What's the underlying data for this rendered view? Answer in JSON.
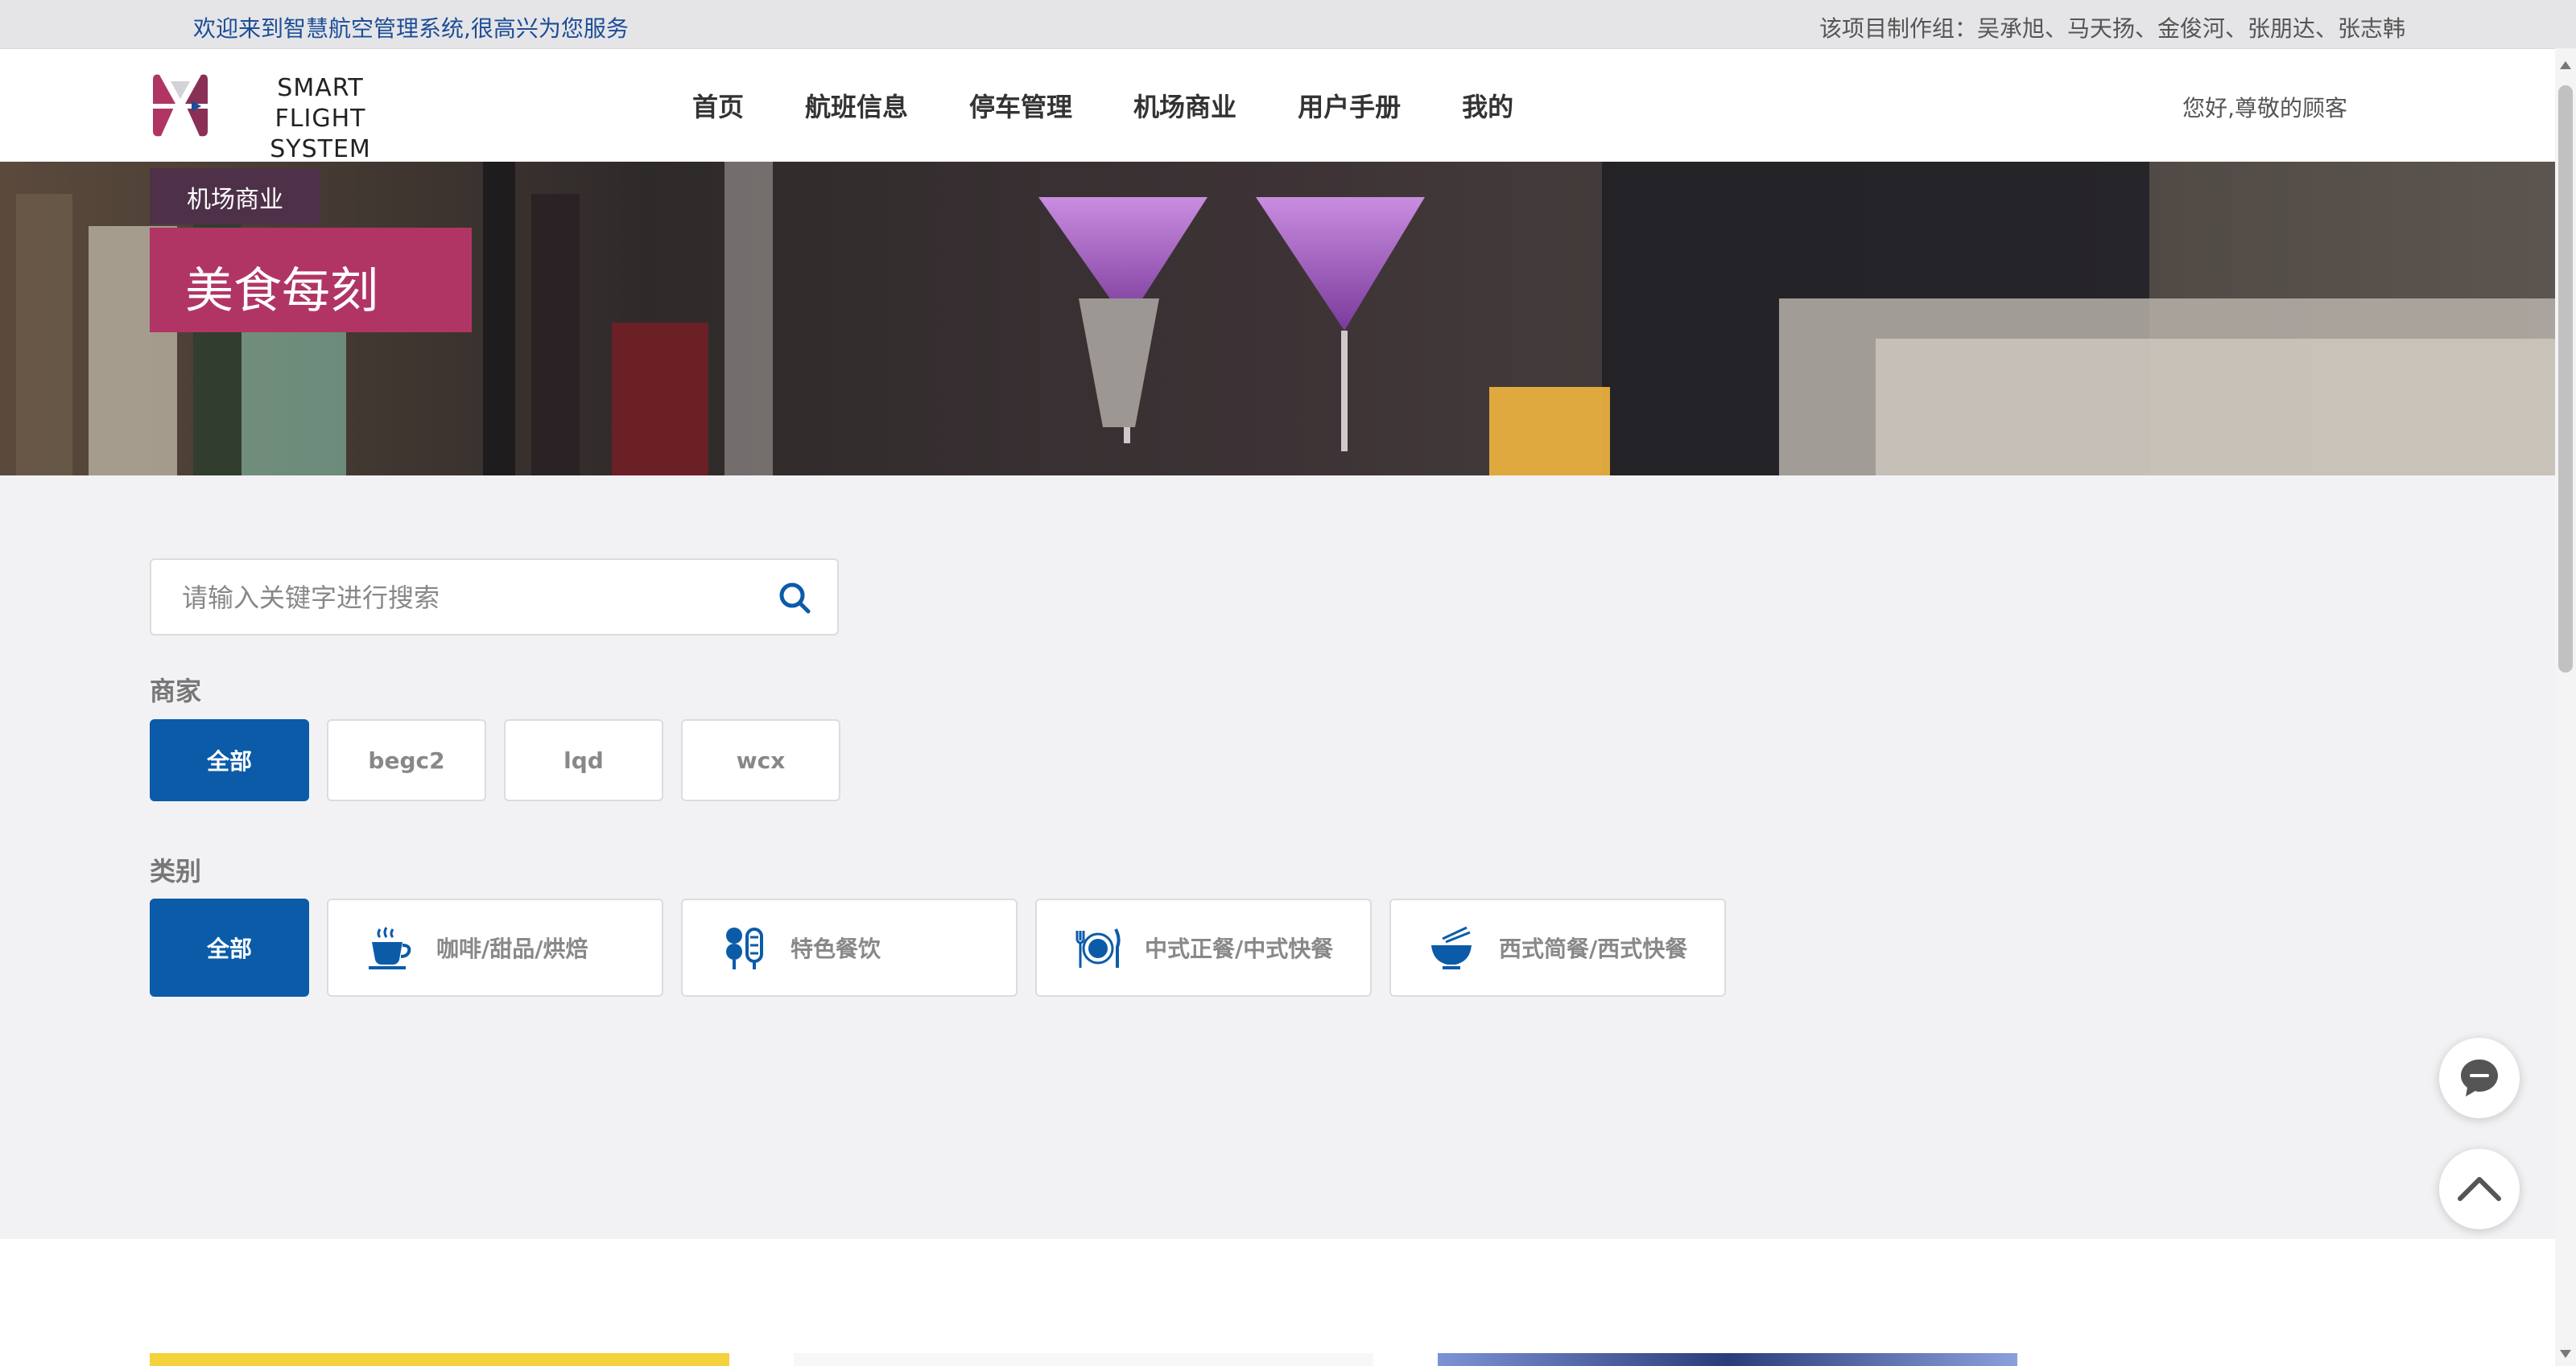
{
  "topbar": {
    "welcome": "欢迎来到智慧航空管理系统,很高兴为您服务",
    "credits": "该项目制作组：吴承旭、马天扬、金俊河、张朋达、张志韩"
  },
  "header": {
    "logo_line1": "SMART FLIGHT",
    "logo_line2": "SYSTEM",
    "nav": [
      "首页",
      "航班信息",
      "停车管理",
      "机场商业",
      "用户手册",
      "我的"
    ],
    "greeting": "您好,尊敬的顾客"
  },
  "banner": {
    "breadcrumb": "机场商业",
    "title": "美食每刻"
  },
  "search": {
    "placeholder": "请输入关键字进行搜索",
    "value": ""
  },
  "filters": {
    "merchant_label": "商家",
    "merchants": [
      "全部",
      "begc2",
      "lqd",
      "wcx"
    ],
    "merchant_selected": "全部",
    "category_label": "类别",
    "categories": [
      {
        "label": "全部",
        "icon": ""
      },
      {
        "label": "咖啡/甜品/烘焙",
        "icon": "coffee-cup-icon"
      },
      {
        "label": "特色餐饮",
        "icon": "skewer-food-icon"
      },
      {
        "label": "中式正餐/中式快餐",
        "icon": "plate-cutlery-icon"
      },
      {
        "label": "西式简餐/西式快餐",
        "icon": "noodle-bowl-icon"
      }
    ],
    "category_selected": "全部"
  },
  "colors": {
    "accent": "#0b5ba9",
    "title_box": "#b03565",
    "breadcrumb_box": "#4e3148"
  }
}
